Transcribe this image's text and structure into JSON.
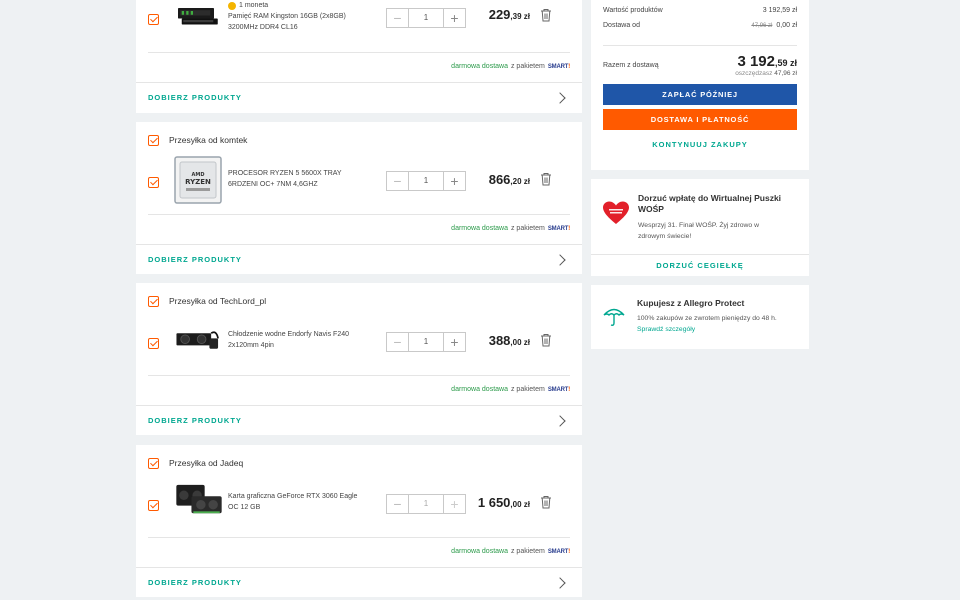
{
  "sellers": [
    {
      "title": "",
      "item": {
        "badge": "1 moneta",
        "name": "Pamięć RAM Kingston 16GB (2x8GB) 3200MHz DDR4 CL16",
        "qty": "1",
        "price_main": "229",
        "price_cents": ",39 zł"
      },
      "delivery_free": "darmowa dostawa",
      "delivery_rest": "z pakietem",
      "choose_label": "DOBIERZ PRODUKTY"
    },
    {
      "title": "Przesyłka od komtek",
      "item": {
        "name": "PROCESOR RYZEN 5 5600X TRAY 6RDZENI OC+ 7NM 4,6GHZ",
        "qty": "1",
        "price_main": "866",
        "price_cents": ",20 zł"
      },
      "delivery_free": "darmowa dostawa",
      "delivery_rest": "z pakietem",
      "choose_label": "DOBIERZ PRODUKTY"
    },
    {
      "title": "Przesyłka od TechLord_pl",
      "item": {
        "name": "Chłodzenie wodne Endorfy Navis F240 2x120mm 4pin",
        "qty": "1",
        "price_main": "388",
        "price_cents": ",00 zł"
      },
      "delivery_free": "darmowa dostawa",
      "delivery_rest": "z pakietem",
      "choose_label": "DOBIERZ PRODUKTY"
    },
    {
      "title": "Przesyłka od Jadeq",
      "item": {
        "name": "Karta graficzna GeForce RTX 3060 Eagle OC 12 GB",
        "qty": "1",
        "price_main": "1 650",
        "price_cents": ",00 zł"
      },
      "delivery_free": "darmowa dostawa",
      "delivery_rest": "z pakietem",
      "choose_label": "DOBIERZ PRODUKTY"
    }
  ],
  "smart_logo": {
    "text": "SMART",
    "mark": "!"
  },
  "summary": {
    "products_label": "Wartość produktów",
    "products_value": "3 192,59 zł",
    "delivery_label": "Dostawa od",
    "delivery_old": "47,96 zł",
    "delivery_value": "0,00 zł",
    "total_label": "Razem z dostawą",
    "total_main": "3 192",
    "total_cents": ",59 zł",
    "saved_label": "oszczędzasz",
    "saved_value": "47,96 zł",
    "pay_later": "ZAPŁAĆ PÓŹNIEJ",
    "delivery_payment": "DOSTAWA I PŁATNOŚĆ",
    "continue": "KONTYNUUJ ZAKUPY"
  },
  "wosp": {
    "title": "Dorzuć wpłatę do Wirtualnej Puszki WOŚP",
    "text": "Wesprzyj 31. Finał WOŚP. Żyj zdrowo w zdrowym świecie!",
    "button": "DORZUĆ CEGIEŁKĘ"
  },
  "protect": {
    "title": "Kupujesz z Allegro Protect",
    "text": "100% zakupów ze zwrotem pieniędzy do 48 h.",
    "link": "Sprawdź szczegóły"
  },
  "colors": {
    "accent_orange": "#ff5a00",
    "accent_blue": "#1f56a8",
    "link_teal": "#00a790",
    "free_green": "#2b9a4a"
  }
}
